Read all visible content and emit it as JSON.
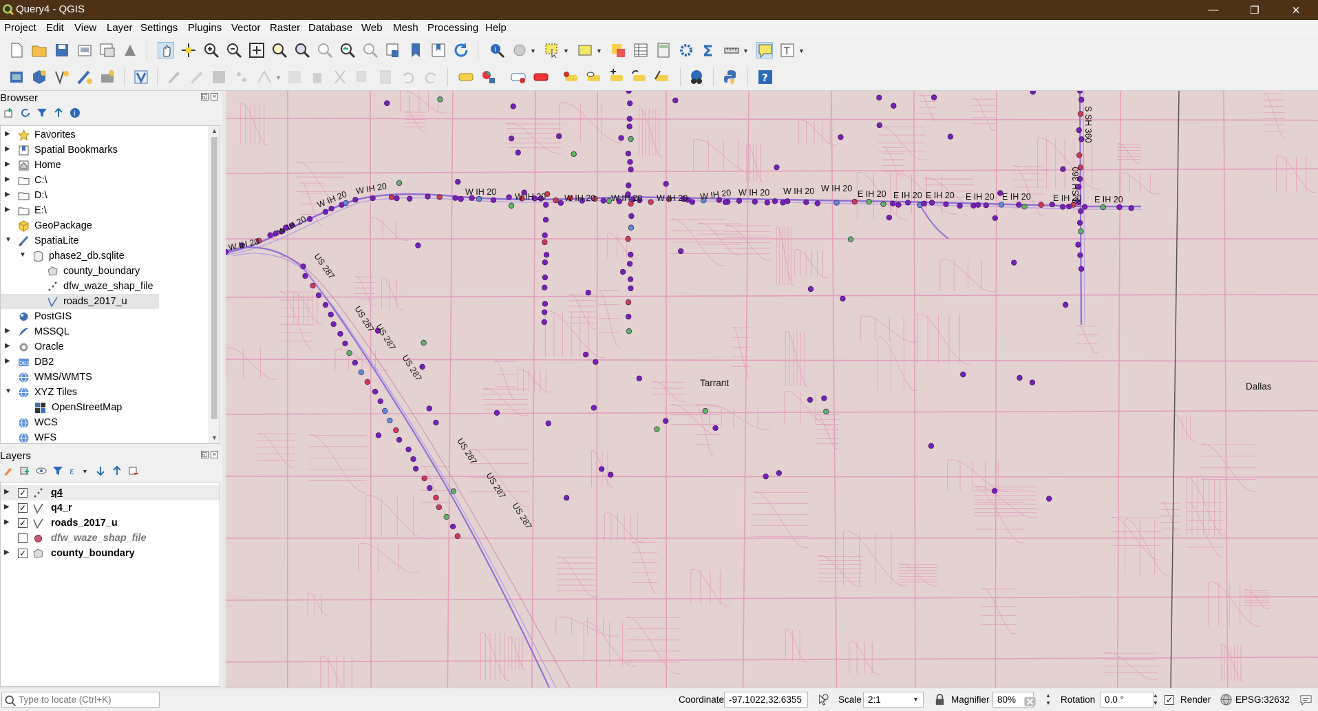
{
  "window": {
    "title": "Query4 - QGIS",
    "minimize": "—",
    "maximize": "❐",
    "close": "✕"
  },
  "menu": [
    "Project",
    "Edit",
    "View",
    "Layer",
    "Settings",
    "Plugins",
    "Vector",
    "Raster",
    "Database",
    "Web",
    "Mesh",
    "Processing",
    "Help"
  ],
  "browser": {
    "title": "Browser",
    "items": [
      {
        "label": "Favorites",
        "icon": "star-icon"
      },
      {
        "label": "Spatial Bookmarks",
        "icon": "bookmark-icon"
      },
      {
        "label": "Home",
        "icon": "home-icon"
      },
      {
        "label": "C:\\",
        "icon": "folder-icon"
      },
      {
        "label": "D:\\",
        "icon": "folder-icon"
      },
      {
        "label": "E:\\",
        "icon": "folder-icon"
      },
      {
        "label": "GeoPackage",
        "icon": "geopackage-icon"
      },
      {
        "label": "SpatiaLite",
        "icon": "spatialite-icon"
      },
      {
        "label": "phase2_db.sqlite",
        "icon": "database-icon"
      },
      {
        "label": "county_boundary",
        "icon": "polygon-layer-icon"
      },
      {
        "label": "dfw_waze_shap_file",
        "icon": "point-layer-icon"
      },
      {
        "label": "roads_2017_u",
        "icon": "line-layer-icon"
      },
      {
        "label": "PostGIS",
        "icon": "postgis-icon"
      },
      {
        "label": "MSSQL",
        "icon": "mssql-icon"
      },
      {
        "label": "Oracle",
        "icon": "oracle-icon"
      },
      {
        "label": "DB2",
        "icon": "db2-icon"
      },
      {
        "label": "WMS/WMTS",
        "icon": "globe-icon"
      },
      {
        "label": "XYZ Tiles",
        "icon": "globe-icon"
      },
      {
        "label": "OpenStreetMap",
        "icon": "tiles-icon"
      },
      {
        "label": "WCS",
        "icon": "globe-icon"
      },
      {
        "label": "WFS",
        "icon": "globe-icon"
      }
    ]
  },
  "layers": {
    "title": "Layers",
    "items": [
      {
        "label": "q4",
        "checked": "✓",
        "icon": "point-layer-icon"
      },
      {
        "label": "q4_r",
        "checked": "✓",
        "icon": "line-layer-icon"
      },
      {
        "label": "roads_2017_u",
        "checked": "✓",
        "icon": "line-layer-icon"
      },
      {
        "label": "dfw_waze_shap_file",
        "checked": "",
        "icon": "point-layer-icon"
      },
      {
        "label": "county_boundary",
        "checked": "✓",
        "icon": "polygon-layer-icon"
      }
    ]
  },
  "map": {
    "road_labels": [
      "W IH 20",
      "US 287",
      "E IH 20",
      "S SH 360"
    ],
    "county_labels": [
      "Tarrant",
      "Dallas"
    ],
    "colors": {
      "background": "#e4d2d1",
      "roads": "#e58fb6",
      "highway": "#8f6fd6",
      "points_primary": "#7a1fb8",
      "points_secondary": "#d03c4a",
      "points_tertiary": "#5cb85c"
    }
  },
  "status": {
    "locator_placeholder": "Type to locate (Ctrl+K)",
    "coordinate_label": "Coordinate",
    "coordinate_value": "-97.1022,32.6355",
    "scale_label": "Scale",
    "scale_value": "2:1",
    "magnifier_label": "Magnifier",
    "magnifier_value": "80%",
    "rotation_label": "Rotation",
    "rotation_value": "0.0 °",
    "render_label": "Render",
    "render_checked": "✓",
    "crs": "EPSG:32632"
  }
}
